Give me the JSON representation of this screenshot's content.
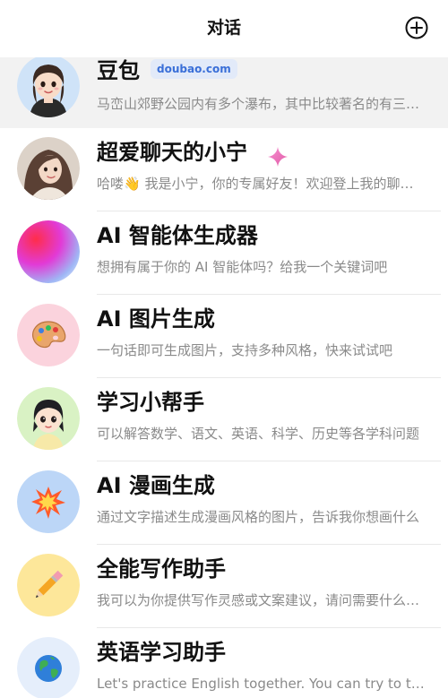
{
  "header": {
    "title": "对话"
  },
  "conversations": [
    {
      "name": "豆包",
      "badge": "doubao.com",
      "preview": "马峦山郊野公园内有多个瀑布，其中比较著名的有三叠瀑等",
      "avatar_icon": "girl-avatar-icon"
    },
    {
      "name": "超爱聊天的小宁",
      "preview": "哈喽👋 我是小宁，你的专属好友！欢迎登上我的聊天号",
      "avatar_icon": "girl-photo-avatar-icon",
      "accent": "#e87bd6"
    },
    {
      "name": "AI 智能体生成器",
      "preview": "想拥有属于你的 AI 智能体吗？给我一个关键词吧",
      "avatar_icon": "gradient-orb-icon"
    },
    {
      "name": "AI 图片生成",
      "preview": "一句话即可生成图片，支持多种风格，快来试试吧",
      "avatar_icon": "palette-icon",
      "avatar_bg": "#fbd3dd"
    },
    {
      "name": "学习小帮手",
      "preview": "可以解答数学、语文、英语、科学、历史等各学科问题",
      "avatar_icon": "student-avatar-icon",
      "avatar_bg": "#d9f2c4"
    },
    {
      "name": "AI 漫画生成",
      "preview": "通过文字描述生成漫画风格的图片，告诉我你想画什么",
      "avatar_icon": "comic-burst-icon",
      "avatar_bg": "#bcd6f7"
    },
    {
      "name": "全能写作助手",
      "preview": "我可以为你提供写作灵感或文案建议，请问需要什么帮助",
      "avatar_icon": "pencil-icon",
      "avatar_bg": "#fde79a"
    },
    {
      "name": "英语学习助手",
      "preview": "Let's practice English together. You can try to talk",
      "avatar_icon": "globe-icon",
      "avatar_bg": "#e5eefb"
    }
  ]
}
